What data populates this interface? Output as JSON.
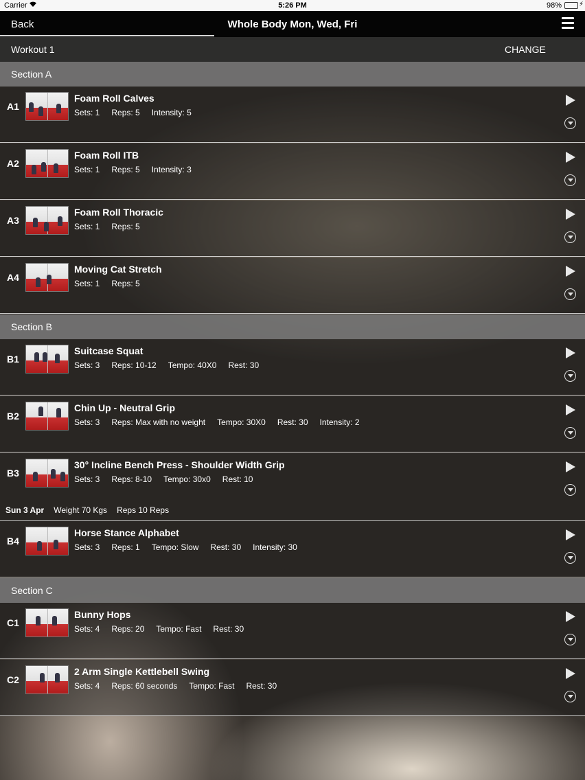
{
  "status_bar": {
    "carrier": "Carrier",
    "time": "5:26 PM",
    "battery": "98%"
  },
  "nav": {
    "back_label": "Back",
    "title": "Whole Body Mon, Wed, Fri"
  },
  "workout": {
    "name": "Workout 1",
    "change_label": "CHANGE"
  },
  "sections": [
    {
      "title": "Section A",
      "exercises": [
        {
          "code": "A1",
          "name": "Foam Roll Calves",
          "stats": [
            "Sets: 1",
            "Reps: 5",
            "Intensity: 5"
          ]
        },
        {
          "code": "A2",
          "name": "Foam Roll ITB",
          "stats": [
            "Sets: 1",
            "Reps: 5",
            "Intensity: 3"
          ]
        },
        {
          "code": "A3",
          "name": "Foam Roll Thoracic",
          "stats": [
            "Sets: 1",
            "Reps: 5"
          ]
        },
        {
          "code": "A4",
          "name": "Moving Cat Stretch",
          "stats": [
            "Sets: 1",
            "Reps: 5"
          ]
        }
      ]
    },
    {
      "title": "Section B",
      "exercises": [
        {
          "code": "B1",
          "name": "Suitcase Squat",
          "stats": [
            "Sets: 3",
            "Reps: 10-12",
            "Tempo: 40X0",
            "Rest: 30"
          ]
        },
        {
          "code": "B2",
          "name": "Chin Up - Neutral Grip",
          "stats": [
            "Sets: 3",
            "Reps: Max with no weight",
            "Tempo: 30X0",
            "Rest: 30",
            "Intensity: 2"
          ]
        },
        {
          "code": "B3",
          "name": "30° Incline Bench Press - Shoulder Width Grip",
          "stats": [
            "Sets: 3",
            "Reps: 8-10",
            "Tempo: 30x0",
            "Rest: 10"
          ],
          "history": {
            "date": "Sun 3 Apr",
            "weight": "Weight 70 Kgs",
            "reps": "Reps 10 Reps"
          }
        },
        {
          "code": "B4",
          "name": "Horse Stance Alphabet",
          "stats": [
            "Sets: 3",
            "Reps: 1",
            "Tempo: Slow",
            "Rest: 30",
            "Intensity: 30"
          ]
        }
      ]
    },
    {
      "title": "Section C",
      "exercises": [
        {
          "code": "C1",
          "name": "Bunny Hops",
          "stats": [
            "Sets: 4",
            "Reps: 20",
            "Tempo: Fast",
            "Rest: 30"
          ]
        },
        {
          "code": "C2",
          "name": "2 Arm Single Kettlebell Swing",
          "stats": [
            "Sets: 4",
            "Reps: 60 seconds",
            "Tempo: Fast",
            "Rest: 30"
          ]
        }
      ]
    }
  ]
}
